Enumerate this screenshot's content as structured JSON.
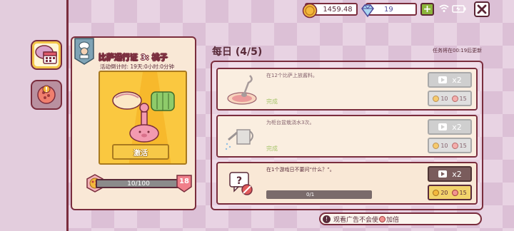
{
  "topbar": {
    "coins": "1459.48",
    "gems": "19",
    "plus_label": "+"
  },
  "pass": {
    "title": "比萨通行证 3: 桃子",
    "countdown": "活动倒计时: 19天:0小时:0分钟",
    "activate_label": "激活",
    "progress_text": "10/100",
    "level": "18"
  },
  "daily": {
    "title": "每日 (4/5)",
    "refresh_note": "任务将在00:19后更新",
    "quests": [
      {
        "text": "在12个比萨上放酱料。",
        "status": "完成",
        "ad_mult": "x2",
        "reward_coins": "10",
        "reward_pizza": "15"
      },
      {
        "text": "为柜台盆栽浇水3次。",
        "status": "完成",
        "ad_mult": "x2",
        "reward_coins": "10",
        "reward_pizza": "15"
      },
      {
        "text": "在1个游戏日不要问“什么？”。",
        "progress": "0/1",
        "ad_mult": "x2",
        "reward_coins": "20",
        "reward_pizza": "15"
      }
    ]
  },
  "footer": {
    "ad_note": "观看广告不会使",
    "ad_note_suffix": "加倍"
  },
  "colors": {
    "border": "#7a2d3d",
    "gold": "#f7b92c",
    "green": "#8bb53b"
  }
}
